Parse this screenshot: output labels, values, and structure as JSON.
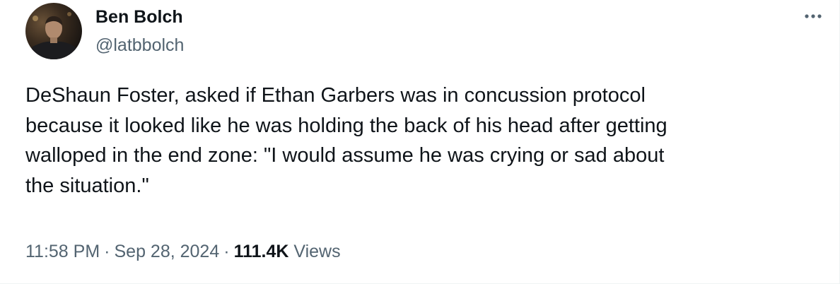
{
  "author": {
    "display_name": "Ben Bolch",
    "handle": "@latbbolch"
  },
  "tweet": {
    "text": "DeShaun Foster, asked if Ethan Garbers was in concussion protocol\nbecause it looked like he was holding the back of his head after getting\nwalloped in the end zone: \"I would assume he was crying or sad about\nthe situation.\"",
    "time": "11:58 PM",
    "date": "Sep 28, 2024",
    "separator": "·",
    "views_count": "111.4K",
    "views_label": "Views"
  },
  "icons": {
    "more": "more-horizontal-icon",
    "avatar": "avatar-photo"
  },
  "colors": {
    "primary_text": "#0f1419",
    "secondary_text": "#536471",
    "background": "#ffffff"
  }
}
